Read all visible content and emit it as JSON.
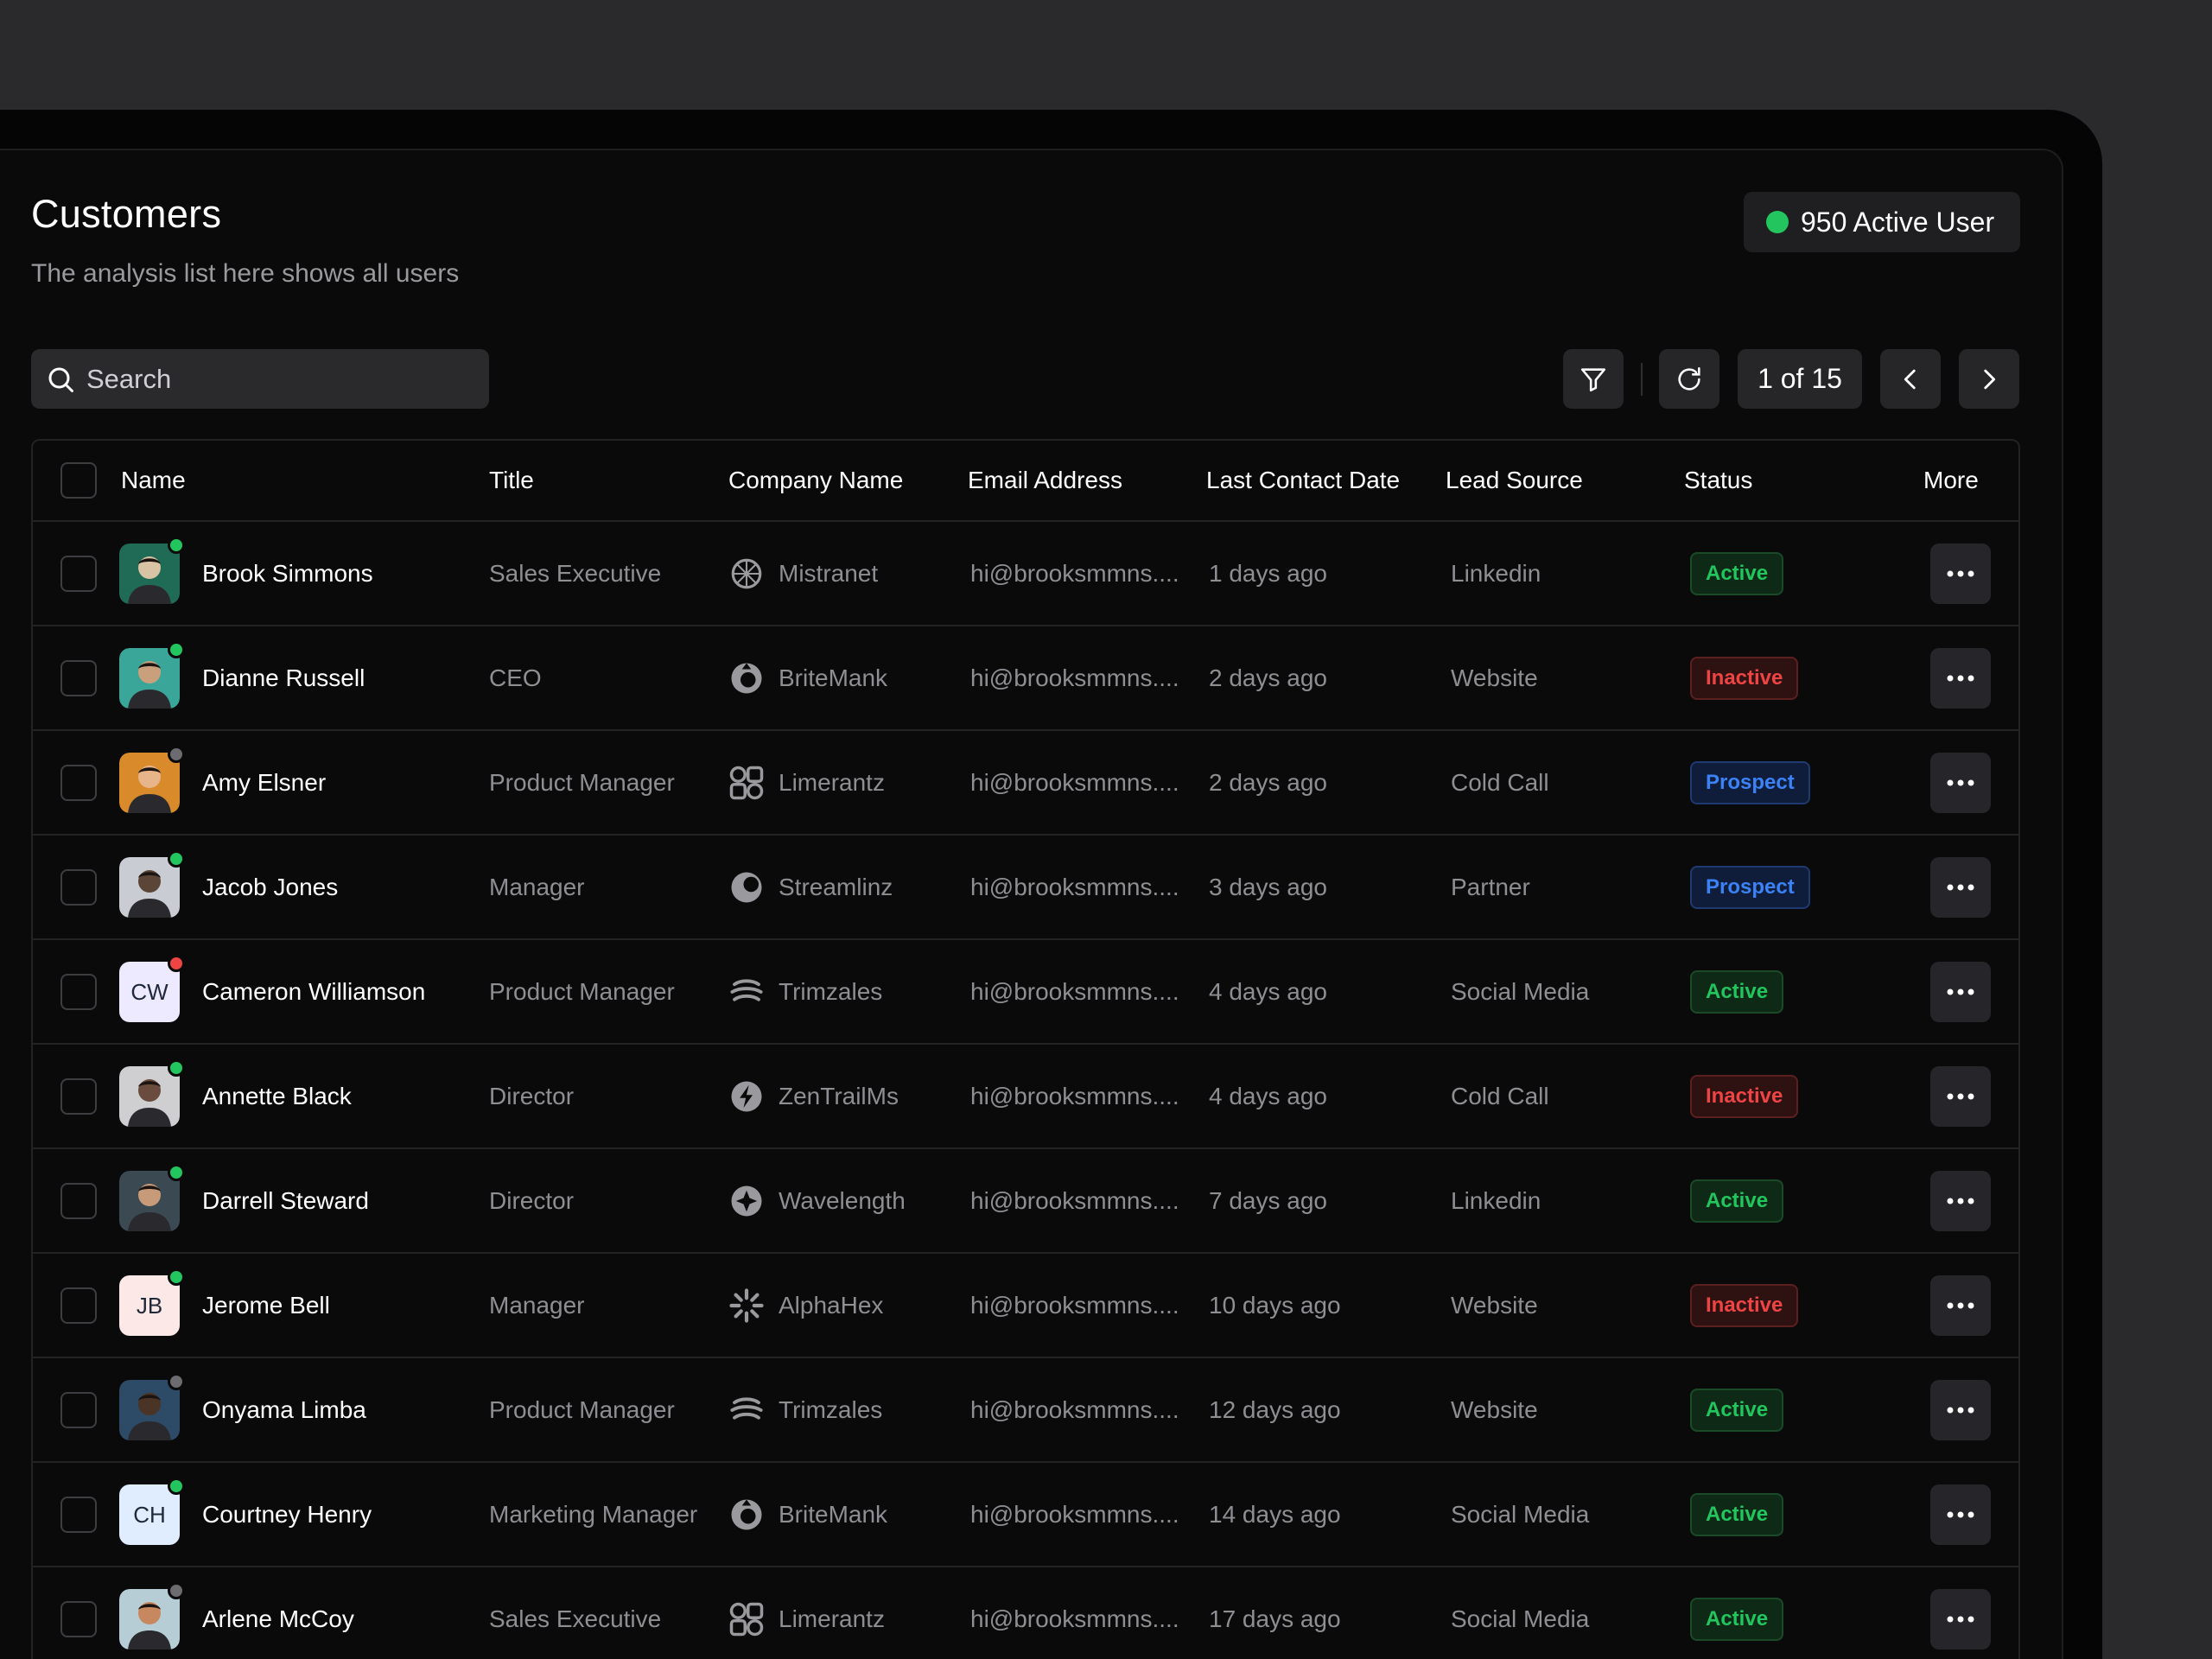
{
  "header": {
    "title": "Customers",
    "subtitle": "The analysis list here shows all users",
    "active_users": "950 Active User",
    "active_color": "#22c55e"
  },
  "toolbar": {
    "search_placeholder": "Search",
    "pagination": "1 of 15"
  },
  "columns": {
    "name": "Name",
    "title": "Title",
    "company": "Company Name",
    "email": "Email Address",
    "last_contact": "Last Contact Date",
    "lead_source": "Lead Source",
    "status": "Status",
    "more": "More"
  },
  "rows": [
    {
      "name": "Brook Simmons",
      "title": "Sales Executive",
      "company": "Mistranet",
      "company_icon": "mistranet-logo-icon",
      "email": "hi@brooksmmns....",
      "last_contact": "1 days ago",
      "lead_source": "Linkedin",
      "status": "Active",
      "avatar": "photo",
      "presence": "online"
    },
    {
      "name": "Dianne Russell",
      "title": "CEO",
      "company": "BriteMank",
      "company_icon": "britemank-logo-icon",
      "email": "hi@brooksmmns....",
      "last_contact": "2 days ago",
      "lead_source": "Website",
      "status": "Inactive",
      "avatar": "photo",
      "presence": "online"
    },
    {
      "name": "Amy Elsner",
      "title": "Product Manager",
      "company": "Limerantz",
      "company_icon": "limerantz-logo-icon",
      "email": "hi@brooksmmns....",
      "last_contact": "2 days ago",
      "lead_source": "Cold Call",
      "status": "Prospect",
      "avatar": "photo",
      "presence": "offline"
    },
    {
      "name": "Jacob Jones",
      "title": "Manager",
      "company": "Streamlinz",
      "company_icon": "streamlinz-logo-icon",
      "email": "hi@brooksmmns....",
      "last_contact": "3 days ago",
      "lead_source": "Partner",
      "status": "Prospect",
      "avatar": "photo",
      "presence": "online"
    },
    {
      "name": "Cameron Williamson",
      "title": "Product Manager",
      "company": "Trimzales",
      "company_icon": "trimzales-logo-icon",
      "email": "hi@brooksmmns....",
      "last_contact": "4 days ago",
      "lead_source": "Social Media",
      "status": "Active",
      "avatar": "CW",
      "presence": "busy"
    },
    {
      "name": "Annette Black",
      "title": "Director",
      "company": "ZenTrailMs",
      "company_icon": "zentrailms-logo-icon",
      "email": "hi@brooksmmns....",
      "last_contact": "4 days ago",
      "lead_source": "Cold Call",
      "status": "Inactive",
      "avatar": "photo",
      "presence": "online"
    },
    {
      "name": "Darrell Steward",
      "title": "Director",
      "company": "Wavelength",
      "company_icon": "wavelength-logo-icon",
      "email": "hi@brooksmmns....",
      "last_contact": "7 days ago",
      "lead_source": "Linkedin",
      "status": "Active",
      "avatar": "photo",
      "presence": "online"
    },
    {
      "name": "Jerome Bell",
      "title": "Manager",
      "company": "AlphaHex",
      "company_icon": "alphahex-logo-icon",
      "email": "hi@brooksmmns....",
      "last_contact": "10 days ago",
      "lead_source": "Website",
      "status": "Inactive",
      "avatar": "JB",
      "presence": "online"
    },
    {
      "name": "Onyama Limba",
      "title": "Product Manager",
      "company": "Trimzales",
      "company_icon": "trimzales-logo-icon",
      "email": "hi@brooksmmns....",
      "last_contact": "12 days ago",
      "lead_source": "Website",
      "status": "Active",
      "avatar": "photo",
      "presence": "offline"
    },
    {
      "name": "Courtney Henry",
      "title": "Marketing Manager",
      "company": "BriteMank",
      "company_icon": "britemank-logo-icon",
      "email": "hi@brooksmmns....",
      "last_contact": "14 days ago",
      "lead_source": "Social Media",
      "status": "Active",
      "avatar": "CH",
      "presence": "online"
    },
    {
      "name": "Arlene McCoy",
      "title": "Sales Executive",
      "company": "Limerantz",
      "company_icon": "limerantz-logo-icon",
      "email": "hi@brooksmmns....",
      "last_contact": "17 days ago",
      "lead_source": "Social Media",
      "status": "Active",
      "avatar": "photo",
      "presence": "offline"
    }
  ],
  "colors": {
    "status_active": "#22c55e",
    "status_inactive": "#ef4444",
    "status_prospect": "#3b82f6",
    "presence_online": "#22c55e",
    "presence_offline": "#6b6b70",
    "presence_busy": "#ef4444"
  }
}
